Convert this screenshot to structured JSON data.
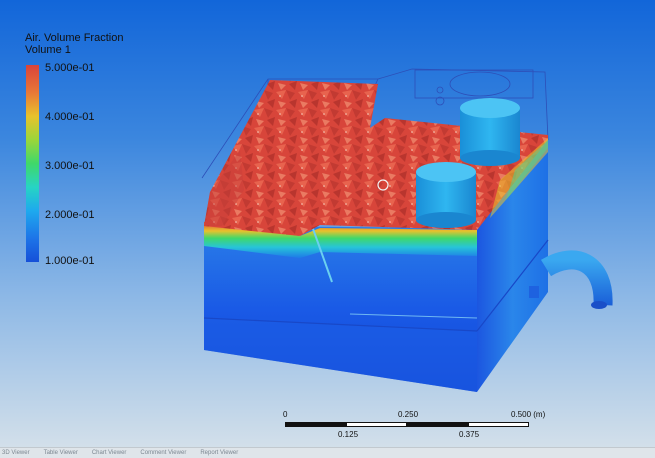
{
  "legend": {
    "title_line1": "Air. Volume Fraction",
    "title_line2": "Volume 1",
    "ticks": [
      "5.000e-01",
      "4.000e-01",
      "3.000e-01",
      "2.000e-01",
      "1.000e-01"
    ]
  },
  "scale_bar": {
    "top_labels": [
      "0",
      "0.250",
      "0.500 (m)"
    ],
    "bottom_labels": [
      "0.125",
      "0.375"
    ]
  },
  "tabs": [
    "3D Viewer",
    "Table Viewer",
    "Chart Viewer",
    "Comment Viewer",
    "Report Viewer"
  ],
  "colors": {
    "air_high": "#d9433a",
    "water_low": "#1650d8",
    "background_top": "#1266d9",
    "background_bottom": "#d7e2ea"
  }
}
